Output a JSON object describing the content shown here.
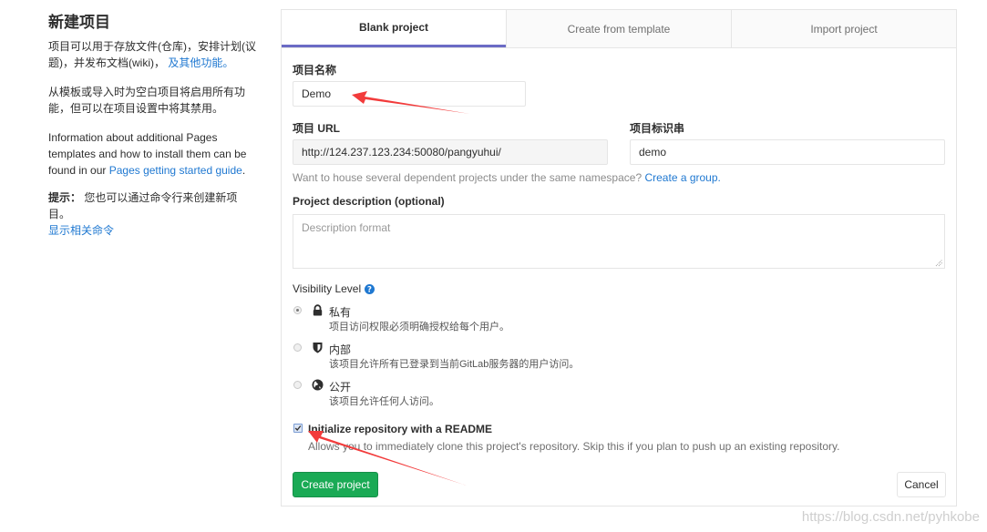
{
  "sidebar": {
    "title": "新建项目",
    "para1_text": "项目可以用于存放文件(仓库)，安排计划(议题)，并发布文档(wiki)，",
    "para1_link": "及其他功能。",
    "para2_text": "从模板或导入时为空白项目将启用所有功能，但可以在项目设置中将其禁用。",
    "para3_text": "Information about additional Pages templates and how to install them can be found in our ",
    "para3_link": "Pages getting started guide",
    "para3_end": ".",
    "tip_label": "提示：",
    "tip_text": " 您也可以通过命令行来创建新项目。",
    "tip_link": "显示相关命令"
  },
  "tabs": [
    {
      "label": "Blank project",
      "active": true
    },
    {
      "label": "Create from template",
      "active": false
    },
    {
      "label": "Import project",
      "active": false
    }
  ],
  "form": {
    "project_name_label": "项目名称",
    "project_name_value": "Demo",
    "project_url_label": "项目 URL",
    "project_url_value": "http://124.237.123.234:50080/pangyuhui/",
    "project_slug_label": "项目标识串",
    "project_slug_value": "demo",
    "namespace_hint": "Want to house several dependent projects under the same namespace? ",
    "namespace_link": "Create a group.",
    "description_label": "Project description (optional)",
    "description_placeholder": "Description format",
    "visibility_label": "Visibility Level",
    "visibility_options": [
      {
        "title": "私有",
        "desc": "项目访问权限必须明确授权给每个用户。",
        "icon": "lock-icon",
        "checked": true
      },
      {
        "title": "内部",
        "desc": "该项目允许所有已登录到当前GitLab服务器的用户访问。",
        "icon": "shield-icon",
        "checked": false
      },
      {
        "title": "公开",
        "desc": "该项目允许任何人访问。",
        "icon": "globe-icon",
        "checked": false
      }
    ],
    "readme_label": "Initialize repository with a README",
    "readme_checked": true,
    "readme_desc": "Allows you to immediately clone this project's repository. Skip this if you plan to push up an existing repository.",
    "create_button": "Create project",
    "cancel_button": "Cancel"
  },
  "colors": {
    "accent_tab": "#6b6bc5",
    "link": "#1f78d1",
    "create_button": "#1aaa55",
    "annotation_arrow": "#f23b3b"
  },
  "watermark": "https://blog.csdn.net/pyhkobe"
}
